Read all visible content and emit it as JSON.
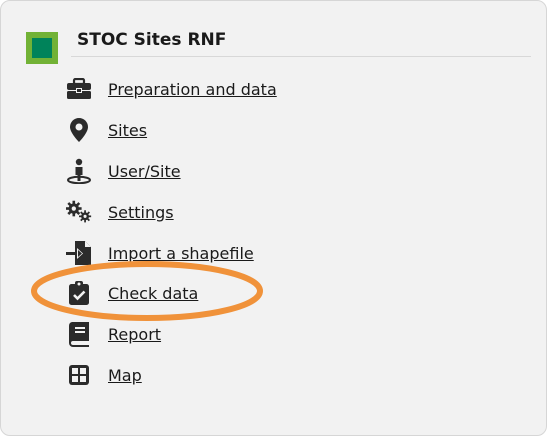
{
  "header": {
    "title": "STOC Sites RNF",
    "badge_colors": {
      "outer": "#72b236",
      "inner": "#00835a"
    }
  },
  "menu": {
    "items": [
      {
        "label": "Preparation and data",
        "icon": "toolbox-icon"
      },
      {
        "label": "Sites",
        "icon": "map-pin-icon"
      },
      {
        "label": "User/Site",
        "icon": "user-location-icon"
      },
      {
        "label": "Settings",
        "icon": "gears-icon"
      },
      {
        "label": "Import a shapefile",
        "icon": "file-import-icon"
      },
      {
        "label": "Check data",
        "icon": "clipboard-check-icon"
      },
      {
        "label": "Report",
        "icon": "book-icon"
      },
      {
        "label": "Map",
        "icon": "grid-map-icon"
      }
    ]
  },
  "highlight": {
    "color": "#f0923a",
    "target": "Check data"
  }
}
